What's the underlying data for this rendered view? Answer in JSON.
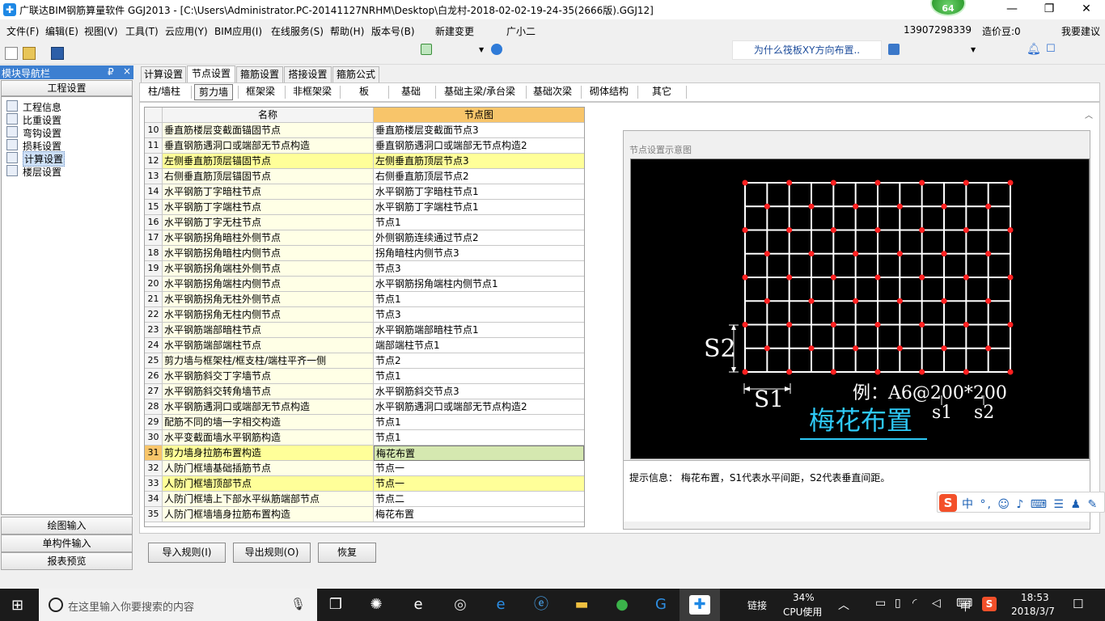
{
  "window": {
    "title": "广联达BIM钢筋算量软件 GGJ2013 - [C:\\Users\\Administrator.PC-20141127NRHM\\Desktop\\白龙村-2018-02-02-19-24-35(2666版).GGJ12]",
    "badge_count": "64",
    "minimize": "—",
    "maximize": "❐",
    "close": "✕"
  },
  "menu": {
    "items": [
      "文件(F)",
      "编辑(E)",
      "视图(V)",
      "工具(T)",
      "云应用(Y)",
      "BIM应用(I)",
      "在线服务(S)",
      "帮助(H)",
      "版本号(B)",
      "新建变更",
      "广小二"
    ],
    "question": "为什么筏板XY方向布置..",
    "account": "13907298339",
    "coins": "造价豆:0",
    "suggest": "我要建议"
  },
  "nav": {
    "title": "模块导航栏",
    "pin": "₽",
    "close": "×",
    "section": "工程设置",
    "items": [
      "工程信息",
      "比重设置",
      "弯钩设置",
      "损耗设置",
      "计算设置",
      "楼层设置"
    ],
    "bottom": [
      "绘图输入",
      "单构件输入",
      "报表预览"
    ]
  },
  "tabs": [
    "计算设置",
    "节点设置",
    "箍筋设置",
    "搭接设置",
    "箍筋公式"
  ],
  "subtabs": [
    "柱/墙柱",
    "剪力墙",
    "框架梁",
    "非框架梁",
    "板",
    "基础",
    "基础主梁/承台梁",
    "基础次梁",
    "砌体结构",
    "其它"
  ],
  "grid": {
    "col_name": "名称",
    "col_node": "节点图",
    "rows": [
      {
        "n": "10",
        "name": "垂直筋楼层变截面锚固节点",
        "node": "垂直筋楼层变截面节点3"
      },
      {
        "n": "11",
        "name": "垂直钢筋遇洞口或端部无节点构造",
        "node": "垂直钢筋遇洞口或端部无节点构造2"
      },
      {
        "n": "12",
        "name": "左侧垂直筋顶层锚固节点",
        "node": "左侧垂直筋顶层节点3"
      },
      {
        "n": "13",
        "name": "右侧垂直筋顶层锚固节点",
        "node": "右侧垂直筋顶层节点2"
      },
      {
        "n": "14",
        "name": "水平钢筋丁字暗柱节点",
        "node": "水平钢筋丁字暗柱节点1"
      },
      {
        "n": "15",
        "name": "水平钢筋丁字端柱节点",
        "node": "水平钢筋丁字端柱节点1"
      },
      {
        "n": "16",
        "name": "水平钢筋丁字无柱节点",
        "node": "节点1"
      },
      {
        "n": "17",
        "name": "水平钢筋拐角暗柱外侧节点",
        "node": "外侧钢筋连续通过节点2"
      },
      {
        "n": "18",
        "name": "水平钢筋拐角暗柱内侧节点",
        "node": "拐角暗柱内侧节点3"
      },
      {
        "n": "19",
        "name": "水平钢筋拐角端柱外侧节点",
        "node": "节点3"
      },
      {
        "n": "20",
        "name": "水平钢筋拐角端柱内侧节点",
        "node": "水平钢筋拐角端柱内侧节点1"
      },
      {
        "n": "21",
        "name": "水平钢筋拐角无柱外侧节点",
        "node": "节点1"
      },
      {
        "n": "22",
        "name": "水平钢筋拐角无柱内侧节点",
        "node": "节点3"
      },
      {
        "n": "23",
        "name": "水平钢筋端部暗柱节点",
        "node": "水平钢筋端部暗柱节点1"
      },
      {
        "n": "24",
        "name": "水平钢筋端部端柱节点",
        "node": "端部端柱节点1"
      },
      {
        "n": "25",
        "name": "剪力墙与框架柱/框支柱/端柱平齐一侧",
        "node": "节点2"
      },
      {
        "n": "26",
        "name": "水平钢筋斜交丁字墙节点",
        "node": "节点1"
      },
      {
        "n": "27",
        "name": "水平钢筋斜交转角墙节点",
        "node": "水平钢筋斜交节点3"
      },
      {
        "n": "28",
        "name": "水平钢筋遇洞口或端部无节点构造",
        "node": "水平钢筋遇洞口或端部无节点构造2"
      },
      {
        "n": "29",
        "name": "配筋不同的墙一字相交构造",
        "node": "节点1"
      },
      {
        "n": "30",
        "name": "水平变截面墙水平钢筋构造",
        "node": "节点1"
      },
      {
        "n": "31",
        "name": "剪力墙身拉筋布置构造",
        "node": "梅花布置"
      },
      {
        "n": "32",
        "name": "人防门框墙基础插筋节点",
        "node": "节点一"
      },
      {
        "n": "33",
        "name": "人防门框墙顶部节点",
        "node": "节点一"
      },
      {
        "n": "34",
        "name": "人防门框墙上下部水平纵筋端部节点",
        "node": "节点二"
      },
      {
        "n": "35",
        "name": "人防门框墙墙身拉筋布置构造",
        "node": "梅花布置"
      }
    ]
  },
  "diagram": {
    "caption": "节点设置示意图",
    "s1": "S1",
    "s2": "S2",
    "example": "例：A6@200*200",
    "title": "梅花布置",
    "lbl_s1": "s1",
    "lbl_s2": "s2",
    "hint": "提示信息： 梅花布置，S1代表水平间距，S2代表垂直间距。"
  },
  "ime": {
    "text": "中 °, ☺ ♪ ⌨ ☰ ♟ ✎"
  },
  "buttons": {
    "import": "导入规则(I)",
    "export": "导出规则(O)",
    "restore": "恢复"
  },
  "taskbar": {
    "search_placeholder": "在这里输入你要搜索的内容",
    "link": "链接",
    "cpu_pct": "34%",
    "cpu_label": "CPU使用",
    "lang": "中",
    "time": "18:53",
    "date": "2018/3/7"
  }
}
